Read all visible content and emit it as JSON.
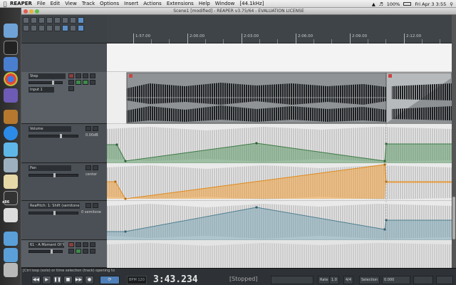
{
  "menubar": {
    "app_name": "REAPER",
    "items": [
      "File",
      "Edit",
      "View",
      "Track",
      "Options",
      "Insert",
      "Actions",
      "Extensions",
      "Help",
      "Window",
      "[44.1kHz]"
    ],
    "battery": "100%",
    "clock": "Fri Apr 3 3:55"
  },
  "window": {
    "title": "Scene1 [modified] - REAPER v3.75/64 - EVALUATION LICENSE"
  },
  "ruler": {
    "labels": [
      "1:57.00",
      "2:00.00",
      "2:03.00",
      "2:06.00",
      "2:09.00",
      "2:12.00"
    ]
  },
  "tracks": {
    "main": {
      "name": "Step",
      "input_label": "Input 1"
    },
    "env_volume": {
      "label": "Volume",
      "value": "0.00dB"
    },
    "env_pan": {
      "label": "Pan",
      "value": "center"
    },
    "env_fx": {
      "label": "ReaPitch: 1: Shift (semitone",
      "value": "0 semitone"
    },
    "bottom": {
      "name": "61 - A Moment Of Ye"
    }
  },
  "envelope_colors": {
    "volume": "#5f9a67",
    "pan": "#f0a13b",
    "fx": "#7da6b5"
  },
  "transport": {
    "status": "[Ctrl loop (solo) or time selection (track) opening to",
    "bpm_label": "BPM",
    "bpm_value": "120",
    "time": "3:43.234",
    "state": "[Stopped]",
    "rate_label": "Rate",
    "rate_value": "1.0",
    "field1": "4/4",
    "selection_label": "Selection",
    "field2": "0.000"
  }
}
